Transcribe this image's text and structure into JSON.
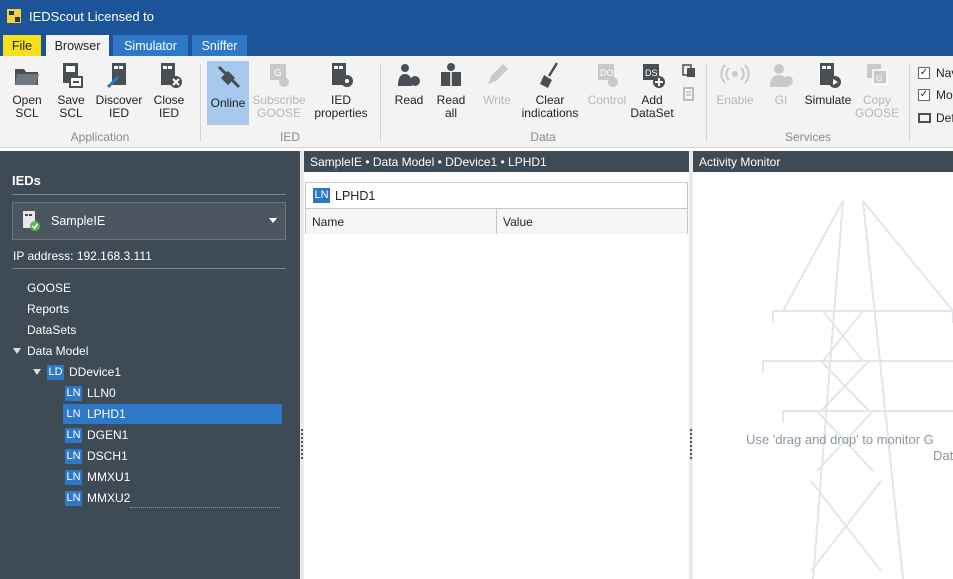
{
  "window": {
    "title": "IEDScout Licensed to"
  },
  "tabs": {
    "file": "File",
    "browser": "Browser",
    "simulator": "Simulator",
    "sniffer": "Sniffer"
  },
  "ribbon": {
    "groups": {
      "application": "Application",
      "ied": "IED",
      "data": "Data",
      "services": "Services"
    },
    "buttons": {
      "open_scl": "Open\nSCL",
      "save_scl": "Save\nSCL",
      "discover_ied": "Discover\nIED",
      "close_ied": "Close\nIED",
      "online": "Online",
      "subscribe_goose": "Subscribe\nGOOSE",
      "ied_properties": "IED\nproperties",
      "read": "Read",
      "read_all": "Read\nall",
      "write": "Write",
      "clear_indications": "Clear\nindications",
      "control": "Control",
      "add_dataset": "Add\nDataSet",
      "enable": "Enable",
      "gi": "GI",
      "simulate": "Simulate",
      "copy_goose": "Copy\nGOOSE"
    },
    "options": {
      "nav": "Nav",
      "mo": "Mo",
      "def": "Def"
    }
  },
  "left_panel": {
    "heading": "IEDs",
    "selected_ied": "SampleIE",
    "ip_label": "IP address:",
    "ip_value": "192.168.3.111",
    "tree": {
      "goose": "GOOSE",
      "reports": "Reports",
      "datasets": "DataSets",
      "data_model": "Data Model",
      "ld_badge": "LD",
      "ld_name": "DDevice1",
      "ln_badge": "LN",
      "nodes": [
        "LLN0",
        "LPHD1",
        "DGEN1",
        "DSCH1",
        "MMXU1",
        "MMXU2"
      ]
    }
  },
  "center_panel": {
    "breadcrumb": "SampleIE • Data Model • DDevice1 • LPHD1",
    "ln_badge": "LN",
    "node_title": "LPHD1",
    "columns": {
      "name": "Name",
      "value": "Value"
    }
  },
  "right_panel": {
    "title": "Activity Monitor",
    "hint_line1": "Use 'drag and drop' to monitor G",
    "hint_line2": "Dat"
  }
}
